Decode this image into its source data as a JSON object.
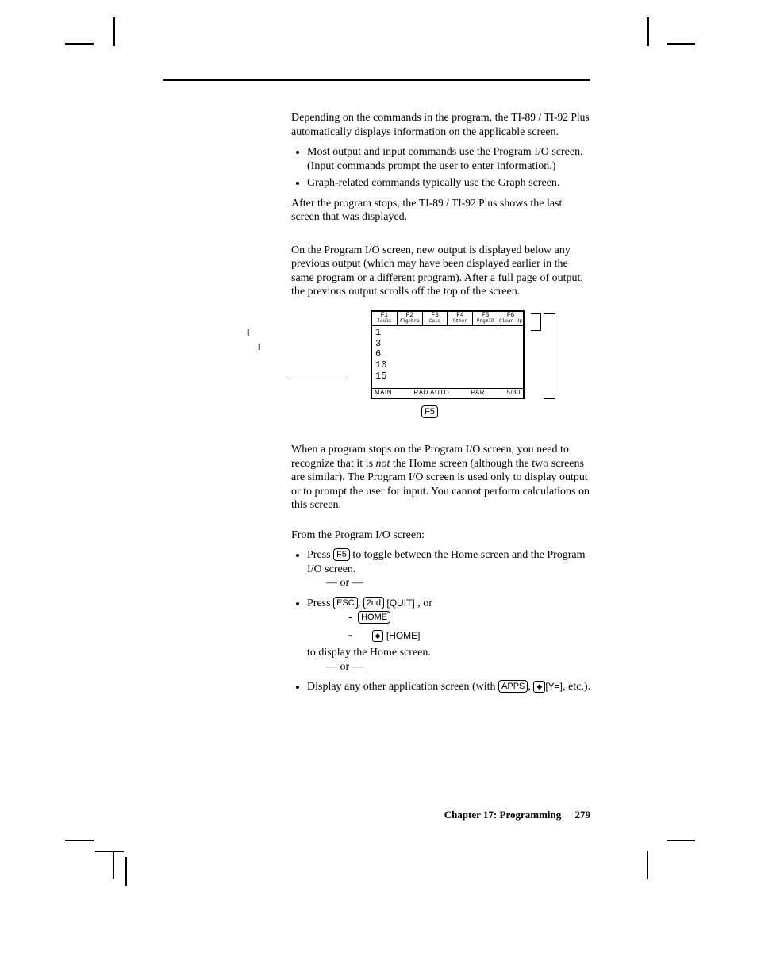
{
  "sidebar": {
    "marker1": "I",
    "marker2": "I"
  },
  "section1": {
    "p1a": "Depending on the commands in the program, the ",
    "model": "TI-89 / TI-92 Plus",
    "p1b": " automatically displays information on the applicable screen.",
    "b1": "Most output and input commands use the Program I/O screen. (Input commands prompt the user to enter information.)",
    "b2": "Graph-related commands typically use the Graph screen.",
    "p2a": "After the program stops, the ",
    "p2b": " shows the last screen that was displayed."
  },
  "section2": {
    "p1": "On the Program I/O screen, new output is displayed below any previous output (which may have been displayed earlier in the same program or a different program). After a full page of output, the previous output scrolls off the top of the screen."
  },
  "figure": {
    "toolbar": {
      "f1": "F1",
      "f1l": "Tools",
      "f2": "F2",
      "f2l": "Algebra",
      "f3": "F3",
      "f3l": "Calc",
      "f4": "F4",
      "f4l": "Other",
      "f5": "F5",
      "f5l": "PrgmIO",
      "f6": "F6",
      "f6l": "Clean Up"
    },
    "lines": [
      "1",
      "3",
      "6",
      "10",
      "15"
    ],
    "status": {
      "folder": "MAIN",
      "mode": "RAD AUTO",
      "graph": "PAR",
      "hist": "5/30"
    },
    "f5key": "F5"
  },
  "section3": {
    "p1a": "When a program stops on the Program I/O screen, you need to recognize that it is ",
    "not": "not",
    "p1b": " the Home screen (although the two screens are similar). The Program I/O screen is used only to display output or to prompt the user for input. You cannot perform calculations on this screen."
  },
  "section4": {
    "intro": "From the Program I/O screen:",
    "b1a": "Press ",
    "b1key": "F5",
    "b1b": " to toggle between the Home screen and the Program I/O screen.",
    "or": "— or —",
    "b2a": "Press ",
    "esc": "ESC",
    "comma": ", ",
    "second": "2nd",
    "quit": " [QUIT]",
    "orword": " , or",
    "home": "HOME",
    "homebr": " [HOME]",
    "b2b": "to display the Home screen.",
    "b3a": "Display any other application screen (with ",
    "apps": "APPS",
    "b3b": ", ",
    "yequals": "[Y=]",
    "b3c": ", etc.)."
  },
  "footer": {
    "chapter": "Chapter 17: Programming",
    "page": "279"
  }
}
